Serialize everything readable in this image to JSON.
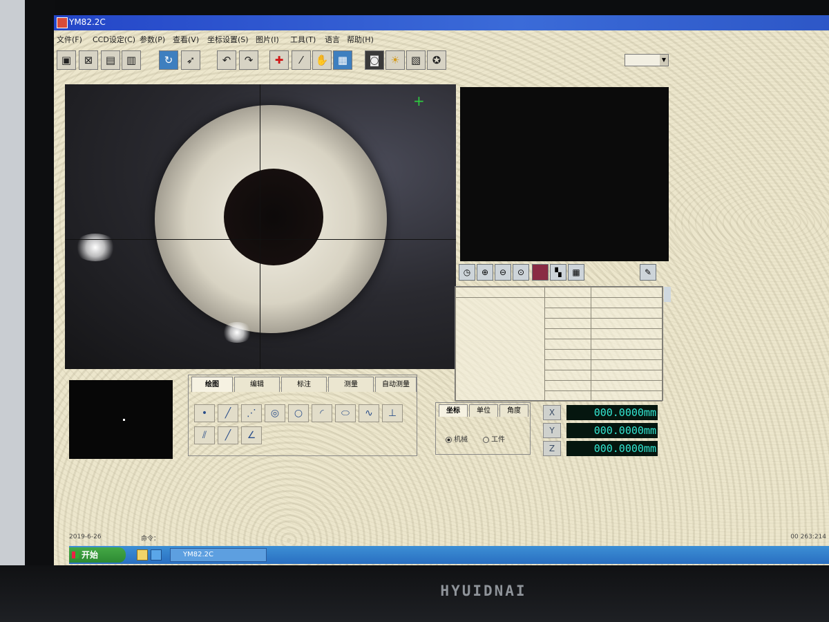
{
  "window": {
    "title": "YM82.2C"
  },
  "menu": [
    "文件(F)",
    "CCD设定(C)",
    "参数(P)",
    "查看(V)",
    "坐标设置(S)",
    "图片(I)",
    "工具(T)",
    "语言",
    "帮助(H)"
  ],
  "draw_panel": {
    "tabs": [
      "绘图",
      "编辑",
      "标注",
      "测量",
      "自动测量"
    ],
    "active_tab": "绘图"
  },
  "coord_panel": {
    "tabs": [
      "坐标",
      "单位",
      "角度"
    ],
    "active_tab": "坐标",
    "radio_machine": "机械",
    "radio_workpiece": "工件",
    "selected": "机械"
  },
  "axes": [
    {
      "label": "X",
      "value": "000.0000mm"
    },
    {
      "label": "Y",
      "value": "000.0000mm"
    },
    {
      "label": "Z",
      "value": "000.0000mm"
    }
  ],
  "status": {
    "date": "2019-6-26",
    "command_label": "命令：",
    "right": "00  263:214"
  },
  "taskbar": {
    "start": "开始",
    "task": "YM82.2C"
  },
  "monitor_brand": "HYUIDNAI",
  "icons": {
    "toolbar": [
      "window-icon",
      "close-window-icon",
      "save-icon",
      "chart-icon",
      "rotate-icon",
      "cursor-icon",
      "undo-icon",
      "redo-icon",
      "crosshair-icon",
      "wand-icon",
      "hand-icon",
      "grid-icon",
      "camera-icon",
      "light-icon",
      "image-icon",
      "settings-icon"
    ],
    "mini_toolbar": [
      "clock-icon",
      "zoom-in-icon",
      "zoom-out-icon",
      "zoom-fit-icon",
      "palette-icon",
      "layout-icon",
      "table-icon",
      "pin-icon"
    ]
  },
  "colors": {
    "axis_value": "#33e7d2",
    "titlebar": "#2446c8",
    "crosshair_green": "#2ecc40"
  }
}
